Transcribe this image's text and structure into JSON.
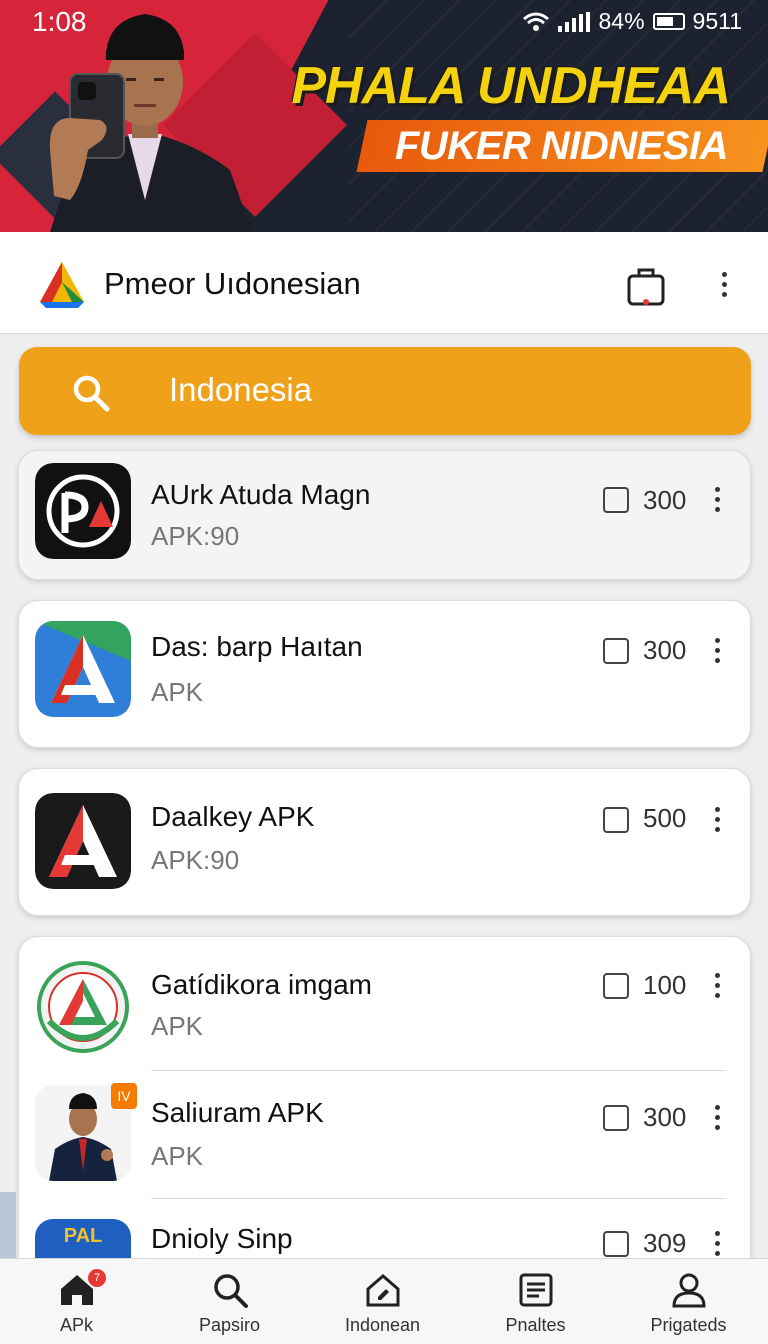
{
  "status_bar": {
    "time": "1:08",
    "battery": "84%",
    "extra": "9511"
  },
  "banner": {
    "headline_line1": "PHALA UNDHEAA",
    "headline_line2": "FUKER NIDNESIA"
  },
  "appbar": {
    "title": "Pmeor Uıdonesian",
    "icons": [
      "app-logo-icon",
      "bag-icon",
      "more-vert-icon"
    ]
  },
  "search": {
    "query": "Indonesia"
  },
  "list": [
    {
      "title": "AUrk Atuda Magn",
      "subtitle": "APK:90",
      "count": "300",
      "icon": "pa-logo"
    },
    {
      "title": "Das: barp Haıtan",
      "subtitle": "APK",
      "count": "300",
      "icon": "a-logo-color"
    },
    {
      "title": "Daalkey APK",
      "subtitle": "APK:90",
      "count": "500",
      "icon": "a-logo-dark"
    },
    {
      "title": "Gatídikora imgam",
      "subtitle": "APK",
      "count": "100",
      "icon": "seal-logo"
    },
    {
      "title": "Saliuram APK",
      "subtitle": "APK",
      "count": "300",
      "icon": "person-photo",
      "badge": "IV"
    },
    {
      "title": "Dnioly Sinp",
      "subtitle": "",
      "count": "309",
      "icon": "pal-logo",
      "icon_text": "PAL"
    }
  ],
  "bottom_nav": [
    {
      "label": "APk",
      "icon": "home-icon",
      "badge": "7"
    },
    {
      "label": "Papsiro",
      "icon": "search-icon"
    },
    {
      "label": "Indonean",
      "icon": "house-edit-icon"
    },
    {
      "label": "Pnaltes",
      "icon": "article-icon"
    },
    {
      "label": "Prigateds",
      "icon": "person-icon"
    }
  ],
  "colors": {
    "accent": "#efa11a",
    "banner_red": "#d6243b",
    "banner_yellow": "#f5d20e",
    "banner_orange": "#e8590c"
  }
}
